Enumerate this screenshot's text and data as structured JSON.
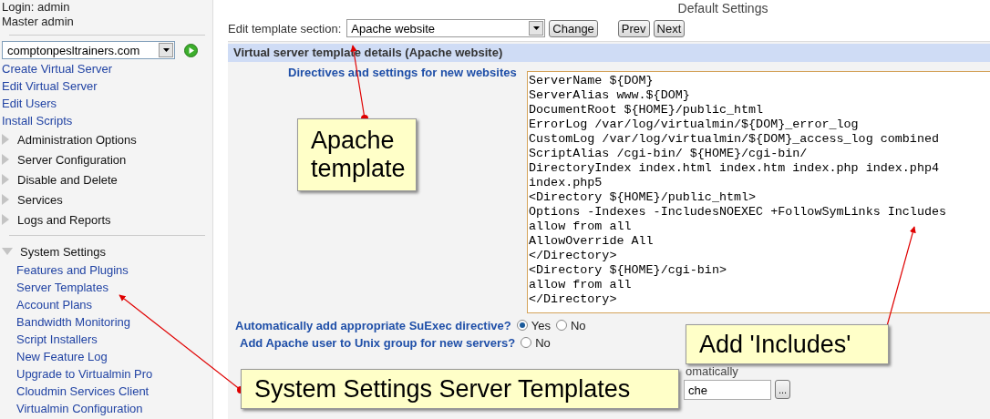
{
  "sidebar": {
    "login": "Login: admin",
    "role": "Master admin",
    "domain_select": "comptonpesltrainers.com",
    "links": [
      "Create Virtual Server",
      "Edit Virtual Server",
      "Edit Users",
      "Install Scripts"
    ],
    "categories": [
      {
        "label": "Administration Options",
        "expanded": false
      },
      {
        "label": "Server Configuration",
        "expanded": false
      },
      {
        "label": "Disable and Delete",
        "expanded": false
      },
      {
        "label": "Services",
        "expanded": false
      },
      {
        "label": "Logs and Reports",
        "expanded": false
      },
      {
        "label": "System Settings",
        "expanded": true,
        "children": [
          "Features and Plugins",
          "Server Templates",
          "Account Plans",
          "Bandwidth Monitoring",
          "Script Installers",
          "New Feature Log",
          "Upgrade to Virtualmin Pro",
          "Cloudmin Services Client",
          "Virtualmin Configuration"
        ]
      }
    ]
  },
  "header": {
    "title": "Default Settings"
  },
  "section_picker": {
    "label": "Edit template section:",
    "value": "Apache website",
    "buttons": [
      "Change",
      "Prev",
      "Next"
    ]
  },
  "panel": {
    "title": "Virtual server template details (Apache website)",
    "directives_label": "Directives and settings for new websites",
    "directives": [
      "ServerName ${DOM}",
      "ServerAlias www.${DOM}",
      "DocumentRoot ${HOME}/public_html",
      "ErrorLog /var/log/virtualmin/${DOM}_error_log",
      "CustomLog /var/log/virtualmin/${DOM}_access_log combined",
      "ScriptAlias /cgi-bin/ ${HOME}/cgi-bin/",
      "DirectoryIndex index.html index.htm index.php index.php4 index.php5",
      "<Directory ${HOME}/public_html>",
      "Options -Indexes -IncludesNOEXEC +FollowSymLinks Includes",
      "allow from all",
      "AllowOverride All",
      "</Directory>",
      "<Directory ${HOME}/cgi-bin>",
      "allow from all",
      "</Directory>"
    ],
    "options": [
      {
        "label": "Automatically add appropriate SuExec directive?",
        "choices": [
          {
            "label": "Yes",
            "selected": true
          },
          {
            "label": "No",
            "selected": false
          }
        ]
      },
      {
        "label": "Add Apache user to Unix group for new servers?",
        "choices": [
          {
            "label": "No",
            "selected": false
          }
        ]
      }
    ],
    "partial_field": {
      "label": "omatically",
      "value": "che",
      "button": "..."
    }
  },
  "callouts": [
    {
      "text": "Apache template"
    },
    {
      "text": "Add 'Includes'"
    },
    {
      "text": "System Settings Server Templates"
    }
  ]
}
